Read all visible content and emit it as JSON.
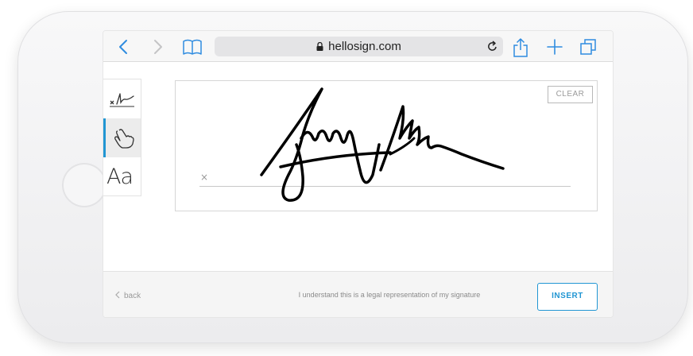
{
  "browser": {
    "url": "hellosign.com",
    "icons": [
      "back-icon",
      "forward-icon",
      "bookmarks-icon",
      "lock-icon",
      "reload-icon",
      "share-icon",
      "new-tab-icon",
      "tabs-icon"
    ]
  },
  "signature_tabs": [
    {
      "id": "draw",
      "icon": "draw-signature-icon",
      "active": false
    },
    {
      "id": "touch",
      "icon": "touch-hand-icon",
      "active": true
    },
    {
      "id": "type",
      "label": "Aa",
      "active": false
    }
  ],
  "pad": {
    "clear_label": "CLEAR",
    "x_mark": "×"
  },
  "footer": {
    "back_label": "back",
    "legal_text": "I understand this is a legal representation of my signature",
    "insert_label": "INSERT"
  },
  "colors": {
    "accent": "#2196d3",
    "ios_blue": "#2f8ce0"
  }
}
